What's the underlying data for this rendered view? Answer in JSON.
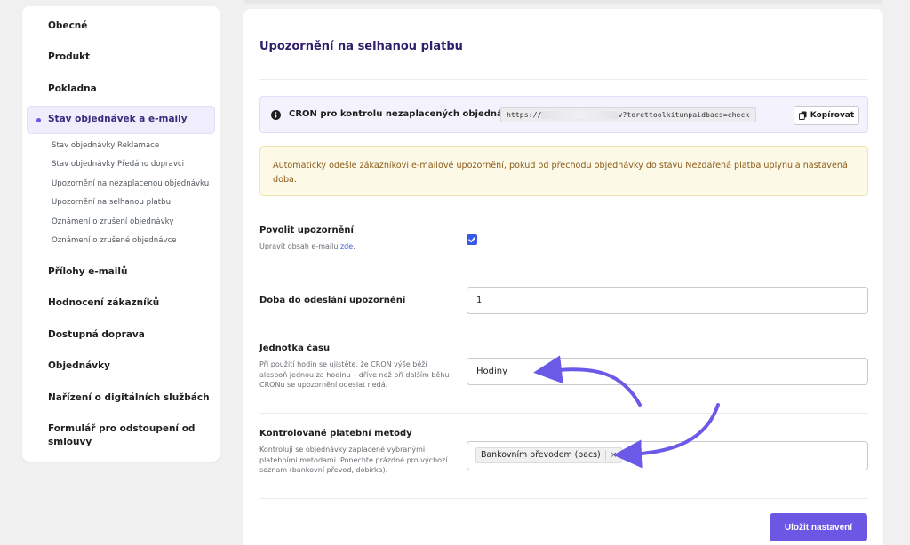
{
  "sidebar": {
    "items_top": [
      {
        "label": "Obecné"
      },
      {
        "label": "Produkt"
      },
      {
        "label": "Pokladna"
      }
    ],
    "active_item": {
      "label": "Stav objednávek a e-maily"
    },
    "sub_items": [
      {
        "label": "Stav objednávky Reklamace"
      },
      {
        "label": "Stav objednávky Předáno dopravci"
      },
      {
        "label": "Upozornění na nezaplacenou objednávku"
      },
      {
        "label": "Upozornění na selhanou platbu"
      },
      {
        "label": "Oznámení o zrušení objednávky"
      },
      {
        "label": "Oznámení o zrušené objednávce"
      }
    ],
    "items_bottom": [
      {
        "label": "Přílohy e-mailů"
      },
      {
        "label": "Hodnocení zákazníků"
      },
      {
        "label": "Dostupná doprava"
      },
      {
        "label": "Objednávky"
      },
      {
        "label": "Nařízení o digitálních službách"
      },
      {
        "label": "Formulář pro odstoupení od smlouvy"
      }
    ]
  },
  "main": {
    "title": "Upozornění na selhanou platbu",
    "cron": {
      "label": "CRON pro kontrolu nezaplacených objednávek:",
      "url_prefix": "https://",
      "url_suffix": "v?torettoolkitunpaidbacs=check",
      "copy_label": "Kopírovat",
      "icon": "info-icon"
    },
    "notice": "Automaticky odešle zákazníkovi e-mailové upozornění, pokud od přechodu objednávky do stavu Nezdařená platba uplynula nastavená doba.",
    "fields": {
      "enable": {
        "label": "Povolit upozornění",
        "desc_prefix": "Upravit obsah e-mailu",
        "desc_link": "zde",
        "desc_suffix": ".",
        "checked": true
      },
      "delay": {
        "label": "Doba do odeslání upozornění",
        "value": "1"
      },
      "unit": {
        "label": "Jednotka času",
        "desc": "Při použití hodin se ujistěte, že CRON výše běží alespoň jednou za hodinu – dříve než při dalším běhu CRONu se upozornění odeslat nedá.",
        "value": "Hodiny"
      },
      "methods": {
        "label": "Kontrolované platební metody",
        "desc": "Kontrolují se objednávky zaplacené vybranými platebními metodami. Ponechte prázdné pro výchozí seznam (bankovní převod, dobírka).",
        "chip": "Bankovním převodem (bacs)",
        "chip_remove": "×"
      }
    },
    "save_label": "Uložit nastavení"
  },
  "colors": {
    "accent": "#6b57e3",
    "checkbox": "#3858e9",
    "notice_bg": "#fdf9e7",
    "notice_text": "#8a5a17",
    "annotation_arrow": "#6b5ae8"
  }
}
